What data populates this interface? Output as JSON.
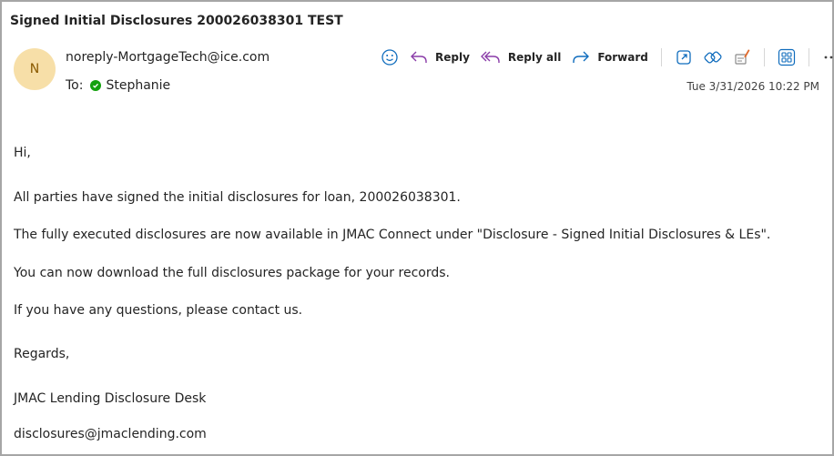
{
  "email": {
    "subject": "Signed Initial Disclosures 200026038301 TEST",
    "sender": {
      "initial": "N",
      "address": "noreply-MortgageTech@ice.com"
    },
    "to_label": "To:",
    "recipient": "Stephanie",
    "timestamp": "Tue 3/31/2026 10:22 PM"
  },
  "toolbar": {
    "reply_label": "Reply",
    "reply_all_label": "Reply all",
    "forward_label": "Forward",
    "icons": [
      "emoji-icon",
      "reply-icon",
      "reply-all-icon",
      "forward-icon",
      "open-in-window-icon",
      "link-icon",
      "sign-icon",
      "apps-icon",
      "more-icon"
    ]
  },
  "body": {
    "greeting": "Hi,",
    "lines": [
      "All parties have signed the initial disclosures for loan, 200026038301.",
      "The fully executed disclosures are now available in JMAC Connect under \"Disclosure - Signed Initial Disclosures & LEs\".",
      "You can now download the full disclosures package for your records.",
      "If you have any questions, please contact us."
    ],
    "closing": "Regards,",
    "signature_name": "JMAC Lending Disclosure Desk",
    "signature_email": "disclosures@jmaclending.com"
  },
  "colors": {
    "accent": "#0f6cbd",
    "reply_all_purple": "#8a3ca8",
    "avatar_bg": "#f7dfa8",
    "status_green": "#13a10e"
  }
}
